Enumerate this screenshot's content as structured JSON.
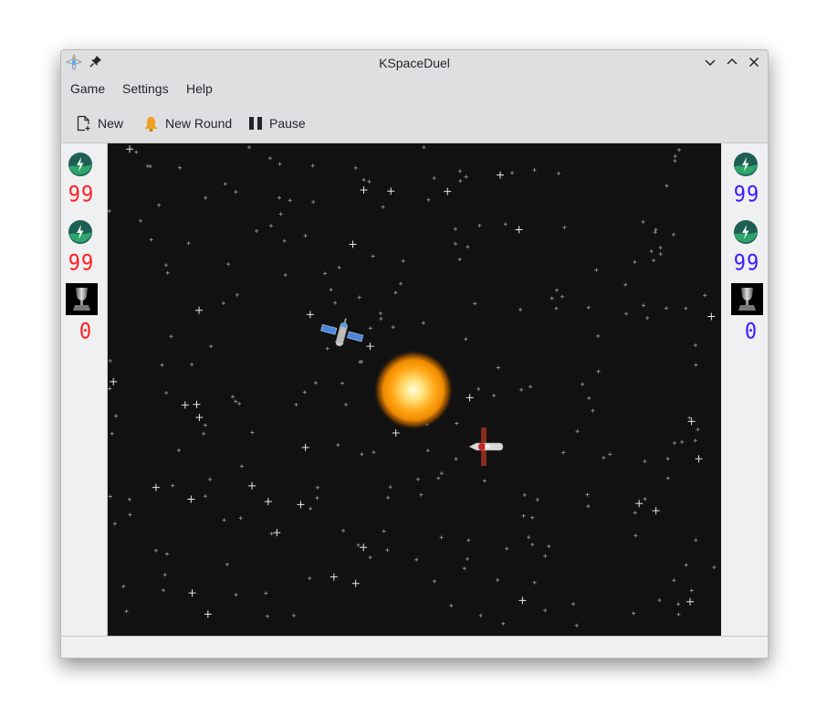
{
  "window": {
    "title": "KSpaceDuel",
    "app_icon": "kspaceduel-ship-icon",
    "pin_icon": "pin-icon",
    "controls": [
      "minimize-icon",
      "maximize-icon",
      "close-icon"
    ]
  },
  "menubar": {
    "items": [
      {
        "label": "Game"
      },
      {
        "label": "Settings"
      },
      {
        "label": "Help"
      }
    ]
  },
  "toolbar": {
    "new_label": "New",
    "new_icon": "document-new-icon",
    "new_round_label": "New Round",
    "new_round_icon": "bell-icon",
    "pause_label": "Pause",
    "pause_icon": "pause-icon"
  },
  "players": {
    "left": {
      "color": "#ff2020",
      "hitpoints": "99",
      "energy": "99",
      "wins": "0"
    },
    "right": {
      "color": "#3a1aff",
      "hitpoints": "99",
      "energy": "99",
      "wins": "0"
    }
  },
  "arena": {
    "background": "#111111",
    "objects": [
      "sun",
      "player-ship-blue",
      "player-ship-red"
    ]
  }
}
